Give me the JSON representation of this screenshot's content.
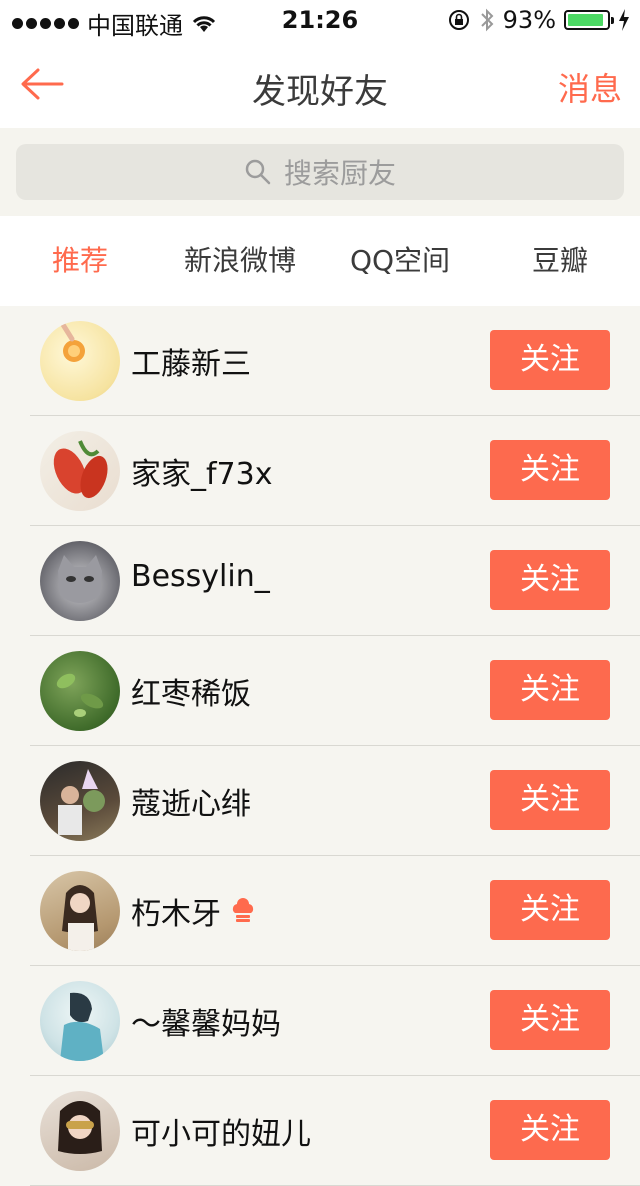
{
  "status_bar": {
    "carrier": "中国联通",
    "time": "21:26",
    "battery_percent": "93%",
    "battery_level": 0.93
  },
  "nav": {
    "back_icon": "back-arrow-icon",
    "title": "发现好友",
    "right_label": "消息"
  },
  "search": {
    "placeholder": "搜索厨友",
    "icon": "search-icon"
  },
  "tabs": [
    {
      "label": "推荐",
      "active": true
    },
    {
      "label": "新浪微博",
      "active": false
    },
    {
      "label": "QQ空间",
      "active": false
    },
    {
      "label": "豆瓣",
      "active": false
    }
  ],
  "friends": [
    {
      "name": "工藤新三",
      "follow_label": "关注"
    },
    {
      "name": "家家_f73x",
      "follow_label": "关注"
    },
    {
      "name": "Bessylin_",
      "follow_label": "关注"
    },
    {
      "name": "红枣稀饭",
      "follow_label": "关注"
    },
    {
      "name": "蔻逝心绯",
      "follow_label": "关注"
    },
    {
      "name": "朽木牙",
      "follow_label": "关注",
      "badge": "chef-hat-icon"
    },
    {
      "name": "～馨馨妈妈",
      "follow_label": "关注"
    },
    {
      "name": "可小可的妞儿",
      "follow_label": "关注"
    }
  ],
  "colors": {
    "accent": "#ff6a4d",
    "follow_button": "#fd6a4e",
    "background": "#f6f5f0"
  }
}
